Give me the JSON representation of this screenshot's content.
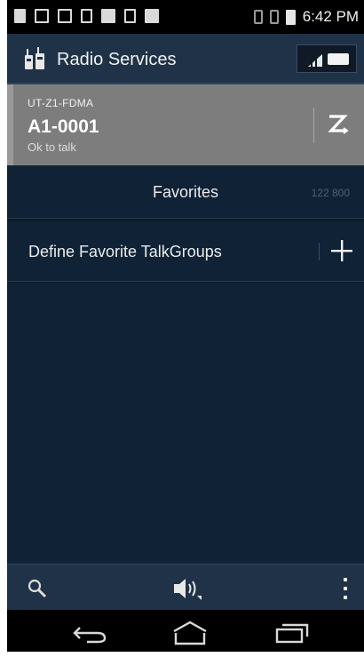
{
  "status_bar": {
    "time": "6:42 PM"
  },
  "action_bar": {
    "title": "Radio Services",
    "logo_icon": "radio-services-icon",
    "signal_icon": "signal-icon",
    "battery_icon": "battery-icon"
  },
  "channel": {
    "zone": "UT-Z1-FDMA",
    "name": "A1-0001",
    "status": "Ok to talk",
    "zone_icon": "zone-switch-icon"
  },
  "favorites": {
    "title": "Favorites",
    "count": "122 800"
  },
  "define_row": {
    "label": "Define Favorite TalkGroups",
    "add_icon": "plus-icon"
  },
  "toolbar": {
    "search_icon": "search-icon",
    "audio_icon": "speaker-icon",
    "menu_icon": "overflow-menu-icon"
  },
  "navbar": {
    "back_icon": "back-icon",
    "home_icon": "home-icon",
    "recent_icon": "recent-apps-icon"
  },
  "colors": {
    "background": "#0f2236",
    "action_bar": "#1f3247",
    "channel_card": "#7d7d7d"
  }
}
